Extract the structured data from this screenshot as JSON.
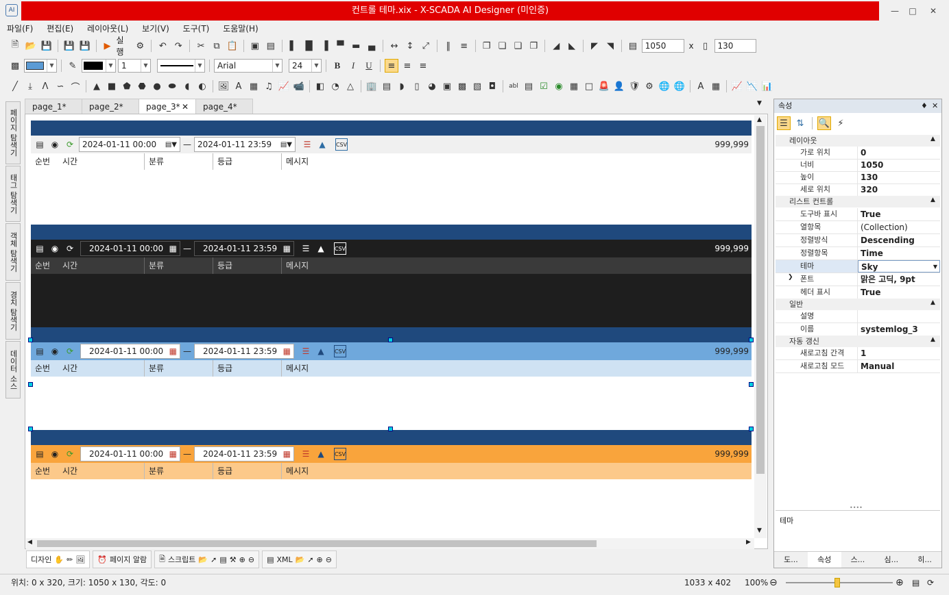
{
  "window": {
    "title": "컨트롤 테마.xix - X-SCADA AI Designer (미인증)"
  },
  "menu": [
    "파일(F)",
    "편집(E)",
    "레이아웃(L)",
    "보기(V)",
    "도구(T)",
    "도움말(H)"
  ],
  "toolbar1": {
    "run_label": "실행",
    "width_value": "1050",
    "x_sep": "x",
    "height_value": "130"
  },
  "toolbar2": {
    "line_width": "1",
    "font_name": "Arial",
    "font_size": "24",
    "bold": "B",
    "italic": "I",
    "underline": "U"
  },
  "left_tabs": [
    "페이지 탐색기",
    "태그 탐색기",
    "객체 탐색기",
    "경치 탐색기",
    "데이터 소스"
  ],
  "doc_tabs": [
    "page_1*",
    "page_2*",
    "page_3*",
    "page_4*"
  ],
  "log_controls": [
    {
      "theme": "default",
      "start": "2024-01-11 00:00",
      "end": "2024-01-11 23:59",
      "count": "999,999"
    },
    {
      "theme": "dark",
      "start": "2024-01-11 00:00",
      "end": "2024-01-11 23:59",
      "count": "999,999"
    },
    {
      "theme": "sky",
      "start": "2024-01-11 00:00",
      "end": "2024-01-11 23:59",
      "count": "999,999"
    },
    {
      "theme": "orange",
      "start": "2024-01-11 00:00",
      "end": "2024-01-11 23:59",
      "count": "999,999"
    }
  ],
  "columns": [
    "순번",
    "시간",
    "분류",
    "등급",
    "메시지"
  ],
  "dash": "—",
  "bottom_tabs": {
    "design": "디자인",
    "page_alarm": "페이지 알람",
    "script": "스크립트",
    "xml": "XML"
  },
  "props": {
    "title": "속성",
    "cat_layout": "레이아웃",
    "x_label": "가로 위치",
    "x_val": "0",
    "w_label": "너비",
    "w_val": "1050",
    "h_label": "높이",
    "h_val": "130",
    "y_label": "세로 위치",
    "y_val": "320",
    "cat_list": "리스트 컨트롤",
    "toolbar_label": "도구바 표시",
    "toolbar_val": "True",
    "columns_label": "열항목",
    "columns_val": "(Collection)",
    "sort_label": "정렬방식",
    "sort_val": "Descending",
    "sortitem_label": "정렬항목",
    "sortitem_val": "Time",
    "theme_label": "테마",
    "theme_val": "Sky",
    "font_label": "폰트",
    "font_val": "맑은 고딕, 9pt",
    "header_label": "헤더 표시",
    "header_val": "True",
    "cat_general": "일반",
    "desc_label": "설명",
    "desc_val": "",
    "name_label": "이름",
    "name_val": "systemlog_3",
    "cat_refresh": "자동 갱신",
    "interval_label": "새로고침 간격",
    "interval_val": "1",
    "mode_label": "새로고침 모드",
    "mode_val": "Manual",
    "desc_panel": "테마",
    "bottom_tabs": [
      "도...",
      "속성",
      "스...",
      "심...",
      "히..."
    ]
  },
  "status": {
    "left": "위치: 0 x 320, 크기: 1050 x 130, 각도: 0",
    "size": "1033 x 402",
    "zoom": "100%"
  }
}
